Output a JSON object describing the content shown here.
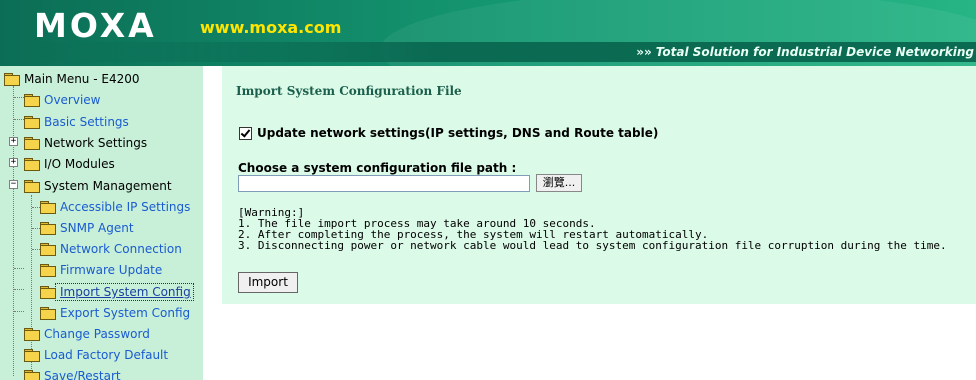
{
  "header": {
    "logo": "MOXA",
    "site": "www.moxa.com",
    "tagline_arrow": "»»",
    "tagline": "Total Solution for Industrial Device Networking"
  },
  "sidebar": {
    "root": "Main Menu - E4200",
    "items": [
      {
        "label": "Overview"
      },
      {
        "label": "Basic Settings"
      },
      {
        "label": "Network Settings"
      },
      {
        "label": "I/O Modules"
      },
      {
        "label": "System Management"
      },
      {
        "label": "Accessible IP Settings"
      },
      {
        "label": "SNMP Agent"
      },
      {
        "label": "Network Connection"
      },
      {
        "label": "Firmware Update"
      },
      {
        "label": "Import System Config"
      },
      {
        "label": "Export System Config"
      },
      {
        "label": "Change Password"
      },
      {
        "label": "Load Factory Default"
      },
      {
        "label": "Save/Restart"
      }
    ]
  },
  "main": {
    "title": "Import System Configuration File",
    "update_checkbox_label": "Update network settings(IP settings, DNS and Route table)",
    "update_checked": true,
    "file_path_label": "Choose a system configuration file path :",
    "file_path_value": "",
    "browse_label": "瀏覽...",
    "warning": {
      "heading": "[Warning:]",
      "lines": [
        "1. The file import process may take around 10 seconds.",
        "2. After completing the process, the system will restart automatically.",
        "3. Disconnecting power or network cable would lead to system configuration file corruption during the time."
      ]
    },
    "import_label": "Import"
  },
  "colors": {
    "header_green": "#0d7a5e",
    "sidebar_bg": "#c8f0d9",
    "panel_bg": "#dcfae8",
    "link_blue": "#1a5bd0",
    "site_yellow": "#ffe500"
  }
}
